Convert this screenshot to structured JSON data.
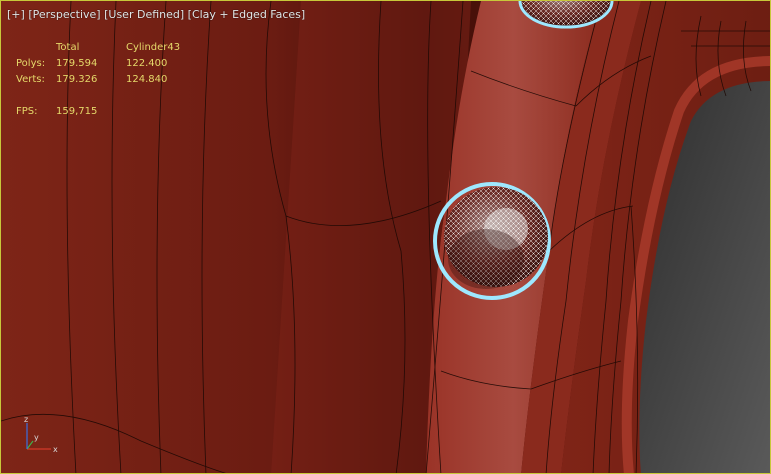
{
  "viewport": {
    "label_plus": "[+]",
    "label_view": "[Perspective]",
    "label_camera": "[User Defined]",
    "label_shading": "[Clay + Edged Faces]"
  },
  "stats": {
    "header_total": "Total",
    "header_object": "Cylinder43",
    "polys_label": "Polys:",
    "polys_total": "179.594",
    "polys_object": "122.400",
    "verts_label": "Verts:",
    "verts_total": "179.326",
    "verts_object": "124.840",
    "fps_label": "FPS:",
    "fps_value": "159,715"
  },
  "axis": {
    "x_label": "x",
    "y_label": "y",
    "z_label": "z"
  },
  "colors": {
    "clay": "#7a2418",
    "clay_light": "#a23628",
    "clay_dark": "#4a1208",
    "selection": "#9ee8ff",
    "viewport_border": "#c8c83a",
    "stats_text": "#e5d86a"
  }
}
